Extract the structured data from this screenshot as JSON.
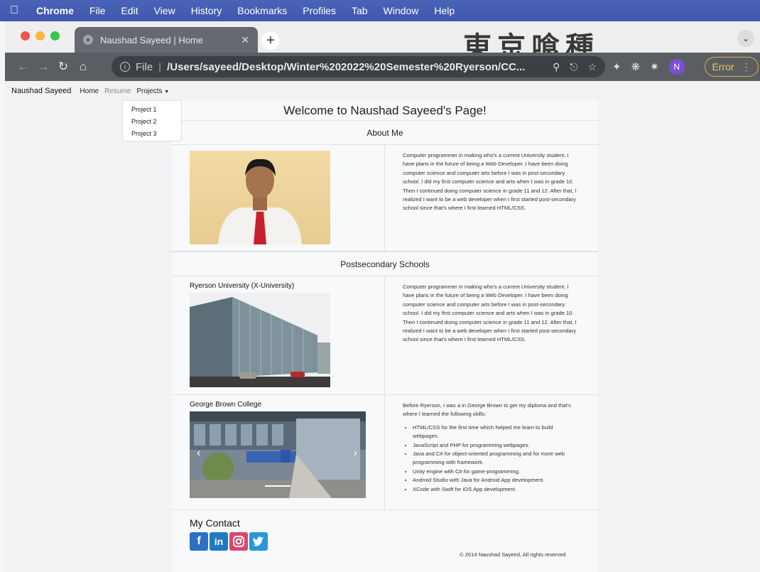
{
  "menubar": {
    "app": "Chrome",
    "items": [
      "File",
      "Edit",
      "View",
      "History",
      "Bookmarks",
      "Profiles",
      "Tab",
      "Window",
      "Help"
    ]
  },
  "browser": {
    "tab_title": "Naushad Sayeed | Home",
    "banner_text": "東京喰種",
    "address_scheme": "File",
    "address_url": "/Users/sayeed/Desktop/Winter%202022%20Semester%20Ryerson/CC...",
    "profile_initial": "N",
    "error_label": "Error"
  },
  "site": {
    "brand": "Naushad Sayeed",
    "nav": [
      "Home",
      "Resume",
      "Projects"
    ],
    "dropdown": [
      "Project 1",
      "Project 2",
      "Project 3"
    ],
    "title": "Welcome to Naushad Sayeed's Page!",
    "about_heading": "About Me",
    "about_text": "Computer programmer in making who's a current University student. I have plans in the future of being a Web Developer. I have been doing computer science and computer arts before I was in post-secondary school. I did my first computer science and arts when I was in grade 10. Then I continued doing computer science in grade 11 and 12. After that, I realized I want to be a web developer when I first started post-secondary school since that's where I first learned HTML/CSS.",
    "schools_heading": "Postsecondary Schools",
    "ryerson_title": "Ryerson University (X-University)",
    "ryerson_text": "Computer programmer in making who's a current University student. I have plans in the future of being a Web Developer. I have been doing computer science and computer arts before I was in post-secondary school. I did my first computer science and arts when I was in grade 10. Then I continued doing computer science in grade 11 and 12. After that, I realized I want to be a web developer when I first started post-secondary school since that's where I first learned HTML/CSS.",
    "gb_title": "George Brown College",
    "gb_intro": "Before Ryerson, I was a in George Brown to get my diploma and that's where I learned the following skills:",
    "gb_skills": [
      "HTML/CSS for the first time which helped me learn to build webpages.",
      "JavaScript and PHP for programming webpages.",
      "Java and C# for object-oriented programming and for more web programming with framework.",
      "Unity engine with C# for game-programming.",
      "Android Studio with Java for Android App development.",
      "XCode with Swift for iOS App development."
    ],
    "contact_heading": "My Contact",
    "footer": "© 2014 Naushad Sayeed, All rights reserved"
  },
  "colors": {
    "menubar": "#4560b4",
    "toolbar": "#5a5e63",
    "facebook": "#2d6fc4",
    "linkedin": "#1f7ac4",
    "instagram": "#d8486b",
    "twitter": "#2796dc"
  }
}
